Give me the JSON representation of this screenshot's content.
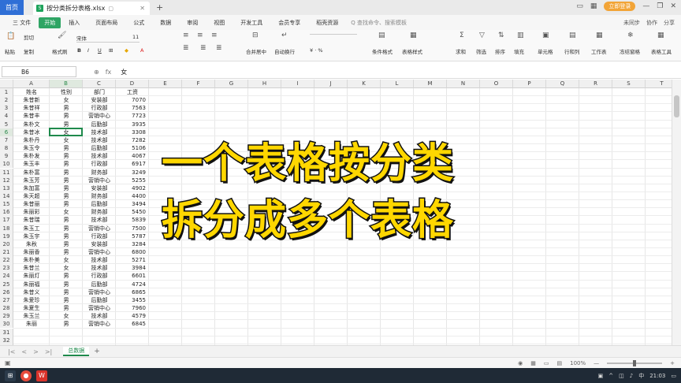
{
  "tabs": {
    "home": "首页",
    "file": "按分类拆分表格.xlsx",
    "file_icon": "S",
    "login": "立即登录"
  },
  "menu": {
    "items": [
      "三 文件",
      "开始",
      "插入",
      "页面布局",
      "公式",
      "数据",
      "审阅",
      "视图",
      "开发工具",
      "会员专享",
      "稻壳资源"
    ],
    "active_index": 1,
    "search": "Q 查找命令、搜索模板",
    "right": [
      "未同步",
      "协作",
      "分享"
    ]
  },
  "ribbon": {
    "font_name": "宋体",
    "font_size": "11",
    "labels": {
      "paste": "粘贴",
      "cut": "剪切",
      "copy": "复制",
      "format_painter": "格式刷",
      "merge": "合并居中",
      "wrap": "自动换行",
      "number_format": "常规",
      "cond_format": "条件格式",
      "table_style": "表格样式",
      "sum": "求和",
      "filter": "筛选",
      "sort": "排序",
      "fill": "填充",
      "cell": "单元格",
      "rowcol": "行和列",
      "worksheet": "工作表",
      "freeze": "冻结窗格",
      "table_tools": "表格工具"
    }
  },
  "formula_bar": {
    "name_box": "B6",
    "content": "女"
  },
  "grid": {
    "columns": [
      "A",
      "B",
      "C",
      "D",
      "E",
      "F",
      "G",
      "H",
      "I",
      "J",
      "K",
      "L",
      "M",
      "N",
      "O",
      "P",
      "Q",
      "R",
      "S",
      "T"
    ],
    "selected_col": "B",
    "selected_row": 6,
    "header": [
      "姓名",
      "性别",
      "部门",
      "工资"
    ],
    "rows": [
      [
        "朱昔新",
        "女",
        "安装部",
        "7070"
      ],
      [
        "朱昔祥",
        "男",
        "行政部",
        "7563"
      ],
      [
        "朱昔丰",
        "男",
        "营销中心",
        "7723"
      ],
      [
        "朱朴文",
        "男",
        "后勤部",
        "3935"
      ],
      [
        "朱昔冰",
        "女",
        "技术部",
        "3308"
      ],
      [
        "朱朴丹",
        "女",
        "技术部",
        "7282"
      ],
      [
        "朱玉令",
        "男",
        "后勤部",
        "5106"
      ],
      [
        "朱朴发",
        "男",
        "技术部",
        "4067"
      ],
      [
        "朱玉丰",
        "男",
        "行政部",
        "6917"
      ],
      [
        "朱朴富",
        "男",
        "财务部",
        "3249"
      ],
      [
        "朱玉芳",
        "男",
        "营销中心",
        "5255"
      ],
      [
        "朱加富",
        "男",
        "安装部",
        "4902"
      ],
      [
        "朱天超",
        "男",
        "财务部",
        "4400"
      ],
      [
        "朱昔丽",
        "男",
        "后勤部",
        "3494"
      ],
      [
        "朱丽彩",
        "女",
        "财务部",
        "5450"
      ],
      [
        "朱昔瑞",
        "男",
        "技术部",
        "5839"
      ],
      [
        "朱玉工",
        "男",
        "营销中心",
        "7500"
      ],
      [
        "朱玉宇",
        "男",
        "行政部",
        "5787"
      ],
      [
        "朱秋",
        "男",
        "安装部",
        "3284"
      ],
      [
        "朱丽香",
        "男",
        "营销中心",
        "6800"
      ],
      [
        "朱朴美",
        "女",
        "技术部",
        "5271"
      ],
      [
        "朱昔兰",
        "女",
        "技术部",
        "3984"
      ],
      [
        "朱丽灯",
        "男",
        "行政部",
        "6601"
      ],
      [
        "朱丽福",
        "男",
        "后勤部",
        "4724"
      ],
      [
        "朱昔义",
        "男",
        "营销中心",
        "6865"
      ],
      [
        "朱爱珍",
        "男",
        "后勤部",
        "3455"
      ],
      [
        "朱夏生",
        "男",
        "营销中心",
        "7960"
      ],
      [
        "朱玉兰",
        "女",
        "技术部",
        "4579"
      ],
      [
        "朱丽",
        "男",
        "营销中心",
        "6845"
      ]
    ]
  },
  "overlay": {
    "line1": "一个表格按分类",
    "line2": "拆分成多个表格"
  },
  "sheet_bar": {
    "active_sheet": "总数据",
    "add": "+"
  },
  "status": {
    "zoom": "100%"
  },
  "taskbar": {
    "time": "21:03"
  }
}
